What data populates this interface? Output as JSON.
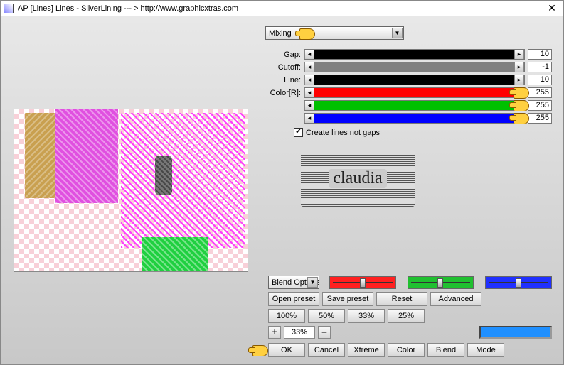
{
  "window": {
    "title": "AP [Lines]  Lines - SilverLining    --- >  http://www.graphicxtras.com",
    "close": "✕"
  },
  "mixing": {
    "label": "Mixing"
  },
  "sliders": {
    "gap": {
      "label": "Gap:",
      "value": "10",
      "fill_color": "#000000",
      "fill_pct": 100
    },
    "cutoff": {
      "label": "Cutoff:",
      "value": "-1",
      "fill_color": "#808080",
      "fill_pct": 100
    },
    "line": {
      "label": "Line:",
      "value": "10",
      "fill_color": "#000000",
      "fill_pct": 100
    },
    "r": {
      "label": "Color[R]:",
      "value": "255",
      "fill_color": "#ff0000",
      "fill_pct": 100
    },
    "g": {
      "label": "",
      "value": "255",
      "fill_color": "#00c000",
      "fill_pct": 100
    },
    "b": {
      "label": "",
      "value": "255",
      "fill_color": "#0000ff",
      "fill_pct": 100
    }
  },
  "create_lines": {
    "label": "Create lines not gaps",
    "checked": true
  },
  "claudia": "claudia",
  "blend_options": {
    "label": "Blend Options"
  },
  "rgb_sliders": {
    "r": "#ff2020",
    "g": "#20c030",
    "b": "#2030ff"
  },
  "buttons": {
    "open_preset": "Open preset",
    "save_preset": "Save preset",
    "reset": "Reset",
    "advanced": "Advanced",
    "p100": "100%",
    "p50": "50%",
    "p33": "33%",
    "p25": "25%",
    "ok": "OK",
    "cancel": "Cancel",
    "xtreme": "Xtreme",
    "color": "Color",
    "blend": "Blend",
    "mode": "Mode"
  },
  "spinner": {
    "plus": "+",
    "value": "33%",
    "minus": "–"
  },
  "swatch_color": "#2090ff"
}
